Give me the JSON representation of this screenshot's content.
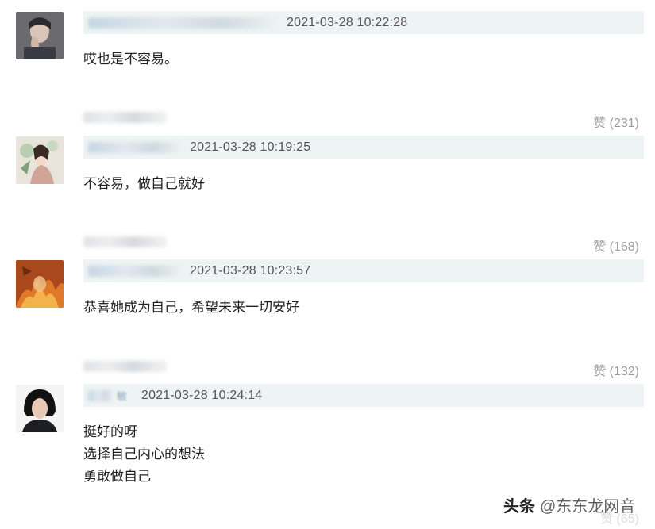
{
  "comments": [
    {
      "avatar": "avatar-man-hand-on-face",
      "name_visible": "",
      "timestamp": "2021-03-28 10:22:28",
      "lines": [
        "哎也是不容易。"
      ],
      "likes": "赞 (231)"
    },
    {
      "avatar": "avatar-woman-illustration",
      "name_visible": "",
      "timestamp": "2021-03-28 10:19:25",
      "lines": [
        "不容易，做自己就好"
      ],
      "likes": "赞 (168)"
    },
    {
      "avatar": "avatar-orange-fire",
      "name_visible": "",
      "timestamp": "2021-03-28 10:23:57",
      "lines": [
        "恭喜她成为自己，希望未来一切安好"
      ],
      "likes": "赞 (132)"
    },
    {
      "avatar": "avatar-woman-dark-hair",
      "name_visible": "敏",
      "timestamp": "2021-03-28 10:24:14",
      "lines": [
        "挺好的呀",
        "选择自己内心的想法",
        "勇敢做自己"
      ],
      "likes": "赞 (65)"
    }
  ],
  "watermark": {
    "logo": "头条",
    "site": "@东东龙网音"
  },
  "colors": {
    "meta_bar_bg": "#eef3f3",
    "like_text": "#9a9a9a",
    "timestamp_text": "#555555"
  }
}
